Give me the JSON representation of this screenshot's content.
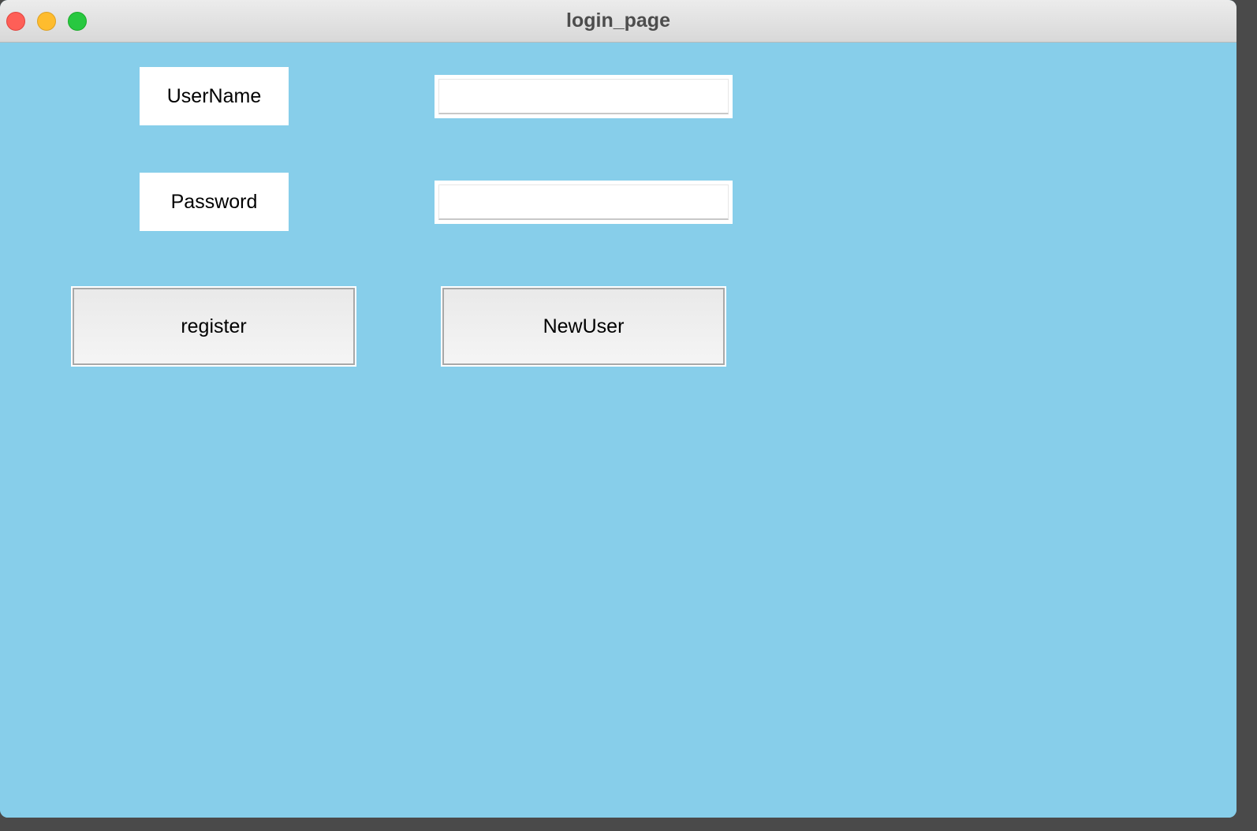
{
  "window": {
    "title": "login_page"
  },
  "form": {
    "username_label": "UserName",
    "username_value": "",
    "password_label": "Password",
    "password_value": ""
  },
  "buttons": {
    "register_label": "register",
    "newuser_label": "NewUser"
  },
  "colors": {
    "background": "#87ceea",
    "label_background": "#ffffff",
    "button_background": "#f0f0f0"
  }
}
